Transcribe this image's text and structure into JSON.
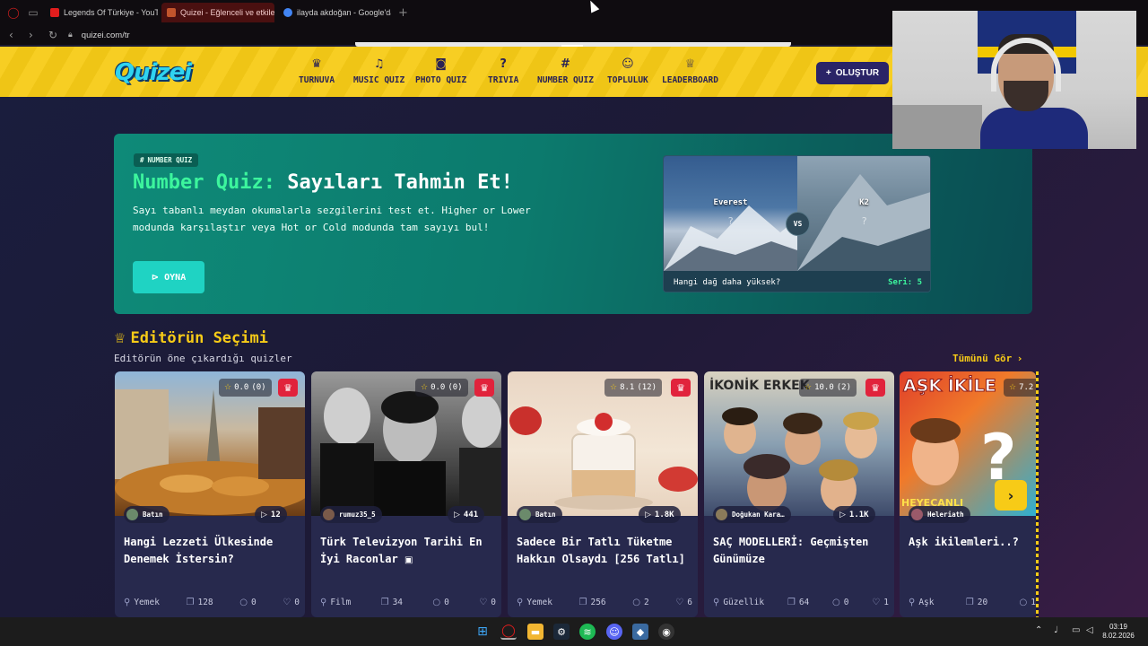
{
  "browser": {
    "tabs": [
      {
        "title": "Legends Of Türkiye - YouTube",
        "color": "#e11d1d"
      },
      {
        "title": "Quizei - Eğlenceli ve etkileşimli",
        "color": "#c2552c"
      },
      {
        "title": "ilayda akdoğan - Google'da Ara",
        "color": "#4285f4"
      }
    ],
    "new_tab_label": "+",
    "url": "quizei.com/tr"
  },
  "header": {
    "logo": "Quizei",
    "nav": [
      {
        "label": "TURNUVA",
        "icon": "trophy-icon",
        "glyph": "♛"
      },
      {
        "label": "MUSIC QUIZ",
        "icon": "music-icon",
        "glyph": "♫"
      },
      {
        "label": "PHOTO QUIZ",
        "icon": "camera-icon",
        "glyph": "◙"
      },
      {
        "label": "TRIVIA",
        "icon": "question-icon",
        "glyph": "?"
      },
      {
        "label": "NUMBER QUIZ",
        "icon": "hash-icon",
        "glyph": "#"
      },
      {
        "label": "TOPLULUK",
        "icon": "users-icon",
        "glyph": "☺"
      },
      {
        "label": "LEADERBOARD",
        "icon": "medal-icon",
        "glyph": "♕"
      }
    ],
    "create_label": "OLUŞTUR"
  },
  "hero": {
    "badge": "NUMBER QUIZ",
    "title_highlight": "Number Quiz:",
    "title_rest": "Sayıları Tahmin Et!",
    "description": "Sayı tabanlı meydan okumalarla sezgilerini test et. Higher or Lower modunda karşılaştır veya Hot or Cold modunda tam sayıyı bul!",
    "play_label": "OYNA",
    "compare": {
      "left": "Everest",
      "right": "K2",
      "left_value": "?",
      "right_value": "?",
      "vs": "VS",
      "question": "Hangi dağ daha yüksek?",
      "streak": "Seri: 5"
    }
  },
  "section": {
    "title": "Editörün Seçimi",
    "subtitle": "Editörün öne çıkardığı quizler",
    "see_all": "Tümünü Gör"
  },
  "cards": [
    {
      "rating": "0.0",
      "votes": "(0)",
      "author": "Batın",
      "plays": "12",
      "title": "Hangi Lezzeti Ülkesinde Denemek İstersin?",
      "category": "Yemek",
      "questions": "128",
      "comments": "0",
      "likes": "0"
    },
    {
      "rating": "0.0",
      "votes": "(0)",
      "author": "rumuz35_5",
      "plays": "441",
      "title": "Türk Televizyon Tarihi En İyi Raconlar",
      "category": "Film",
      "questions": "34",
      "comments": "0",
      "likes": "0"
    },
    {
      "rating": "8.1",
      "votes": "(12)",
      "author": "Batın",
      "plays": "1.8K",
      "title": "Sadece Bir Tatlı Tüketme Hakkın Olsaydı [256 Tatlı]",
      "category": "Yemek",
      "questions": "256",
      "comments": "2",
      "likes": "6"
    },
    {
      "rating": "10.0",
      "votes": "(2)",
      "author": "Doğukan Kara…",
      "plays": "1.1K",
      "title": "SAÇ MODELLERİ: Geçmişten Günümüze",
      "category": "Güzellik",
      "questions": "64",
      "comments": "0",
      "likes": "1"
    },
    {
      "rating": "7.2",
      "votes": "",
      "author": "Heleriath",
      "plays": "",
      "title": "Aşk ikilemleri..?",
      "category": "Aşk",
      "questions": "20",
      "comments": "1",
      "likes": ""
    }
  ],
  "taskbar": {
    "time": "03:19",
    "date": "8.02.2026"
  }
}
